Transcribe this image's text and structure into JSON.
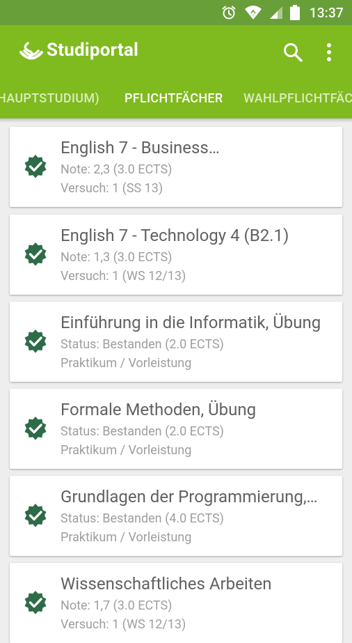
{
  "status_bar": {
    "time": "13:37",
    "icons": [
      "alarm-icon",
      "wifi-icon",
      "signal-icon",
      "battery-icon"
    ]
  },
  "app_bar": {
    "title": "Studiportal",
    "logo_icon": "studiportal-logo-icon",
    "search_icon": "search-icon",
    "menu_icon": "more-vert-icon"
  },
  "tabs": [
    {
      "label": "HAUPTSTUDIUM)",
      "active": false
    },
    {
      "label": "PFLICHTFÄCHER",
      "active": true
    },
    {
      "label": "WAHLPFLICHTFÄC",
      "active": false
    }
  ],
  "colors": {
    "appbar": "#7fba1f",
    "statusbar": "#689f38",
    "check": "#2e6b47",
    "background": "#eeeeee"
  },
  "courses": [
    {
      "title": "English 7 - Business…",
      "line1": "Note: 2,3 (3.0 ECTS)",
      "line2": "Versuch: 1 (SS 13)",
      "icon": "check-badge-icon"
    },
    {
      "title": "English 7 - Technology 4 (B2.1)",
      "line1": "Note: 1,3 (3.0 ECTS)",
      "line2": "Versuch: 1 (WS 12/13)",
      "icon": "check-badge-icon"
    },
    {
      "title": "Einführung in die Informatik, Übung",
      "line1": "Status: Bestanden (2.0 ECTS)",
      "line2": "Praktikum / Vorleistung",
      "icon": "check-badge-icon"
    },
    {
      "title": "Formale Methoden, Übung",
      "line1": "Status: Bestanden (2.0 ECTS)",
      "line2": "Praktikum / Vorleistung",
      "icon": "check-badge-icon"
    },
    {
      "title": "Grundlagen der Programmierung,…",
      "line1": "Status: Bestanden (4.0 ECTS)",
      "line2": "Praktikum / Vorleistung",
      "icon": "check-badge-icon"
    },
    {
      "title": "Wissenschaftliches Arbeiten",
      "line1": "Note: 1,7 (3.0 ECTS)",
      "line2": "Versuch: 1 (WS 12/13)",
      "icon": "check-badge-icon"
    }
  ]
}
